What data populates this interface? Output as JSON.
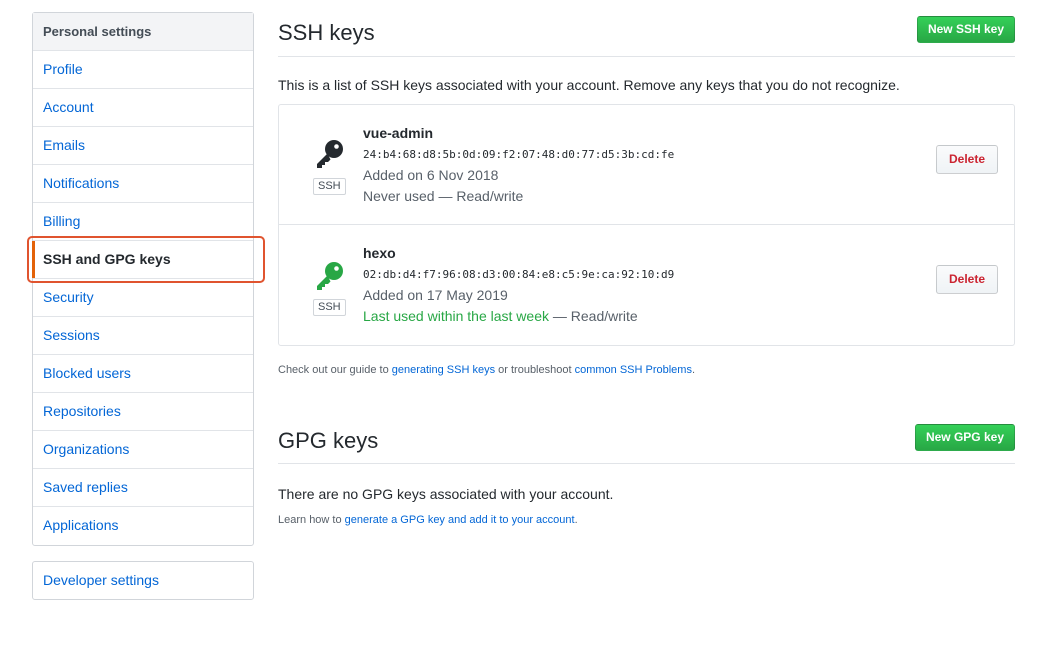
{
  "sidebar": {
    "heading": "Personal settings",
    "items": [
      {
        "label": "Profile"
      },
      {
        "label": "Account"
      },
      {
        "label": "Emails"
      },
      {
        "label": "Notifications"
      },
      {
        "label": "Billing"
      },
      {
        "label": "SSH and GPG keys",
        "selected": true
      },
      {
        "label": "Security"
      },
      {
        "label": "Sessions"
      },
      {
        "label": "Blocked users"
      },
      {
        "label": "Repositories"
      },
      {
        "label": "Organizations"
      },
      {
        "label": "Saved replies"
      },
      {
        "label": "Applications"
      }
    ],
    "developer": "Developer settings"
  },
  "ssh": {
    "title": "SSH keys",
    "new_button": "New SSH key",
    "description": "This is a list of SSH keys associated with your account. Remove any keys that you do not recognize.",
    "keys": [
      {
        "title": "vue-admin",
        "fingerprint": "24:b4:68:d8:5b:0d:09:f2:07:48:d0:77:d5:3b:cd:fe",
        "added": "Added on 6 Nov 2018",
        "usage": "Never used",
        "usage_suffix": " — Read/write",
        "icon": "key-icon",
        "icon_color": "#24292e",
        "type_label": "SSH",
        "delete_label": "Delete"
      },
      {
        "title": "hexo",
        "fingerprint": "02:db:d4:f7:96:08:d3:00:84:e8:c5:9e:ca:92:10:d9",
        "added": "Added on 17 May 2019",
        "usage": "Last used within the last week",
        "usage_suffix": " — Read/write",
        "icon": "key-icon",
        "icon_color": "#28a745",
        "type_label": "SSH",
        "delete_label": "Delete"
      }
    ],
    "guide_prefix": "Check out our guide to ",
    "guide_link1": "generating SSH keys",
    "guide_middle": " or troubleshoot ",
    "guide_link2": "common SSH Problems",
    "guide_suffix": "."
  },
  "gpg": {
    "title": "GPG keys",
    "new_button": "New GPG key",
    "empty": "There are no GPG keys associated with your account.",
    "learn_prefix": "Learn how to ",
    "learn_link": "generate a GPG key and add it to your account",
    "learn_suffix": "."
  },
  "colors": {
    "accent_link": "#0366d6",
    "selected_bar": "#e36209",
    "highlight": "#e0542f",
    "green_button": "#2ea44f",
    "delete_text": "#cb2431"
  }
}
